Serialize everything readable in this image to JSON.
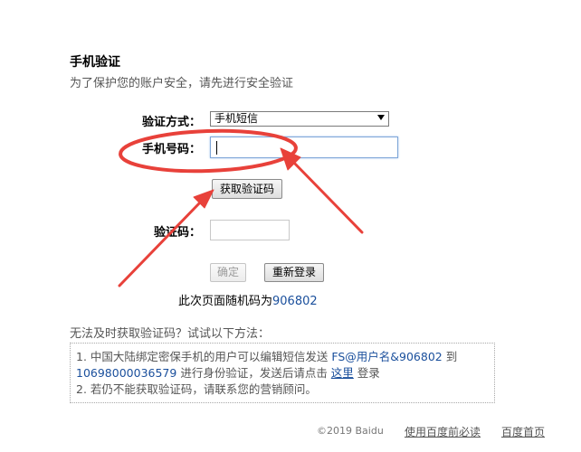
{
  "header": {
    "title": "手机验证",
    "subtitle": "为了保护您的账户安全，请先进行安全验证"
  },
  "form": {
    "method_label": "验证方式：",
    "method_value": "手机短信",
    "phone_label": "手机号码：",
    "phone_value": "",
    "get_code_button": "获取验证码",
    "code_label": "验证码：",
    "code_value": "",
    "confirm_button": "确定",
    "relogin_button": "重新登录",
    "random_prefix": "此次页面随机码为",
    "random_code": "906802"
  },
  "alternatives": {
    "title": "无法及时获取验证码？试试以下方法：",
    "line1_text": "1. 中国大陆绑定密保手机的用户可以编辑短信发送 ",
    "line1_sms": "FS@用户名&906802",
    "line1_to": " 到",
    "line2_number": "10698000036579",
    "line2_text": " 进行身份验证，发送后请点击 ",
    "line2_link": "这里",
    "line2_end": " 登录",
    "line3_text": "2. 若仍不能获取验证码，请联系您的营销顾问。"
  },
  "footer": {
    "copyright": "©2019  Baidu",
    "link_usage": "使用百度前必读",
    "link_home": "百度首页"
  },
  "annotation": {
    "color": "#e8413a"
  },
  "icons": {
    "select_arrow": "chevron-down-icon"
  }
}
